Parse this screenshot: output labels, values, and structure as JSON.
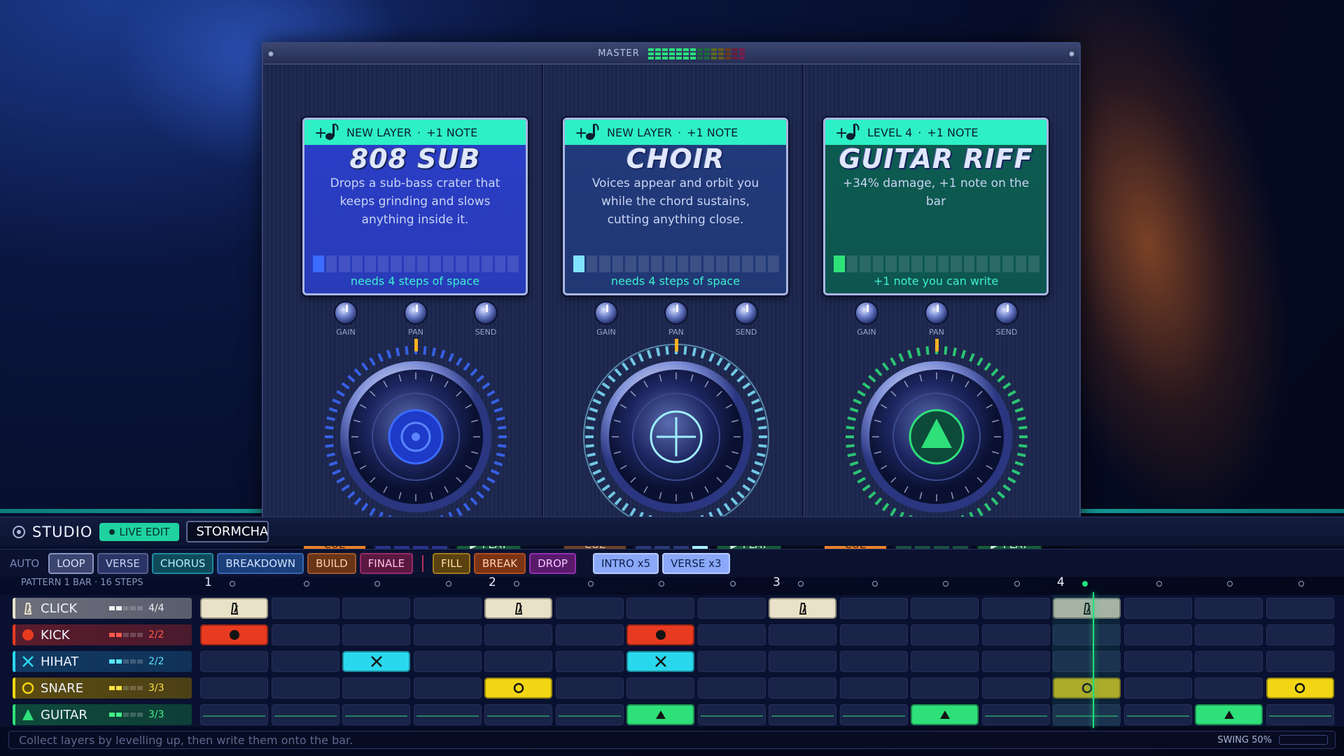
{
  "master": {
    "title": "MASTER"
  },
  "layers": [
    {
      "badge": "NEW LAYER",
      "bonus": "+1 NOTE",
      "name": "808 SUB",
      "description": "Drops a sub-bass crater that keeps grinding and slows anything inside it.",
      "footer": "needs 4 steps of space",
      "color": "#2a3ec8",
      "accent": "#3b6bff",
      "knobs": [
        "GAIN",
        "PAN",
        "SEND"
      ],
      "cue_label": "CUE",
      "play_label": "PLAY",
      "cue_active": true,
      "dial_icon": "target-icon"
    },
    {
      "badge": "NEW LAYER",
      "bonus": "+1 NOTE",
      "name": "CHOIR",
      "description": "Voices appear and orbit you while the chord sustains, cutting anything close.",
      "footer": "needs 4 steps of space",
      "color": "#213a7a",
      "accent": "#7fe4ff",
      "knobs": [
        "GAIN",
        "PAN",
        "SEND"
      ],
      "cue_label": "CUE",
      "play_label": "PLAY",
      "cue_active": false,
      "dial_icon": "crosshair-icon"
    },
    {
      "badge": "LEVEL 4",
      "bonus": "+1 NOTE",
      "name": "GUITAR RIFF",
      "description": "+34% damage, +1 note on the bar",
      "footer": "+1 note you can write",
      "color": "#0c5c50",
      "accent": "#2ee07a",
      "knobs": [
        "GAIN",
        "PAN",
        "SEND"
      ],
      "cue_label": "CUE",
      "play_label": "PLAY",
      "cue_active": true,
      "dial_icon": "triangle-icon"
    }
  ],
  "studio": {
    "title": "STUDIO",
    "live_edit": "LIVE EDIT",
    "song": "STORMCHA"
  },
  "sections": {
    "auto_label": "AUTO",
    "items": [
      {
        "label": "LOOP",
        "bg": "#3b4570",
        "fg": "#d6dcf4",
        "border": "#8a94c0"
      },
      {
        "label": "VERSE",
        "bg": "#2b3466",
        "fg": "#c8d0f0",
        "border": "#55608f"
      },
      {
        "label": "CHORUS",
        "bg": "#0e4a5a",
        "fg": "#aef0ff",
        "border": "#1f8aa0"
      },
      {
        "label": "BREAKDOWN",
        "bg": "#1b3f7a",
        "fg": "#cfe0ff",
        "border": "#3866b0"
      },
      {
        "label": "BUILD",
        "bg": "#6a3418",
        "fg": "#ffd0a8",
        "border": "#a0562c"
      },
      {
        "label": "FINALE",
        "bg": "#5a1840",
        "fg": "#ffc0e0",
        "border": "#962a6a"
      },
      {
        "label": "FILL",
        "bg": "#5a4210",
        "fg": "#ffe0a0",
        "border": "#a07a1c"
      },
      {
        "label": "BREAK",
        "bg": "#7a3414",
        "fg": "#ffd0b0",
        "border": "#b04e20"
      },
      {
        "label": "DROP",
        "bg": "#5a1a6a",
        "fg": "#f0c8ff",
        "border": "#9430b0"
      },
      {
        "label": "INTRO x5",
        "bg": "#8aa8f8",
        "fg": "#102050",
        "border": "#b8ccff"
      },
      {
        "label": "VERSE x3",
        "bg": "#8aa8f8",
        "fg": "#102050",
        "border": "#b8ccff"
      }
    ]
  },
  "pattern": {
    "label": "PATTERN  1 BAR · 16 STEPS",
    "beats": [
      "1",
      "2",
      "3",
      "4"
    ],
    "playhead_step": 13
  },
  "tracks": [
    {
      "name": "CLICK",
      "count": "4/4",
      "color": "#e9e2c8",
      "label_bg": "#6d6f7c",
      "count_color": "#f0f0f0",
      "icon": "metronome-icon",
      "steps": [
        1,
        5,
        9,
        13
      ]
    },
    {
      "name": "KICK",
      "count": "2/2",
      "color": "#e83a20",
      "label_bg": "#5a1c2c",
      "count_color": "#ff5a4a",
      "icon": "circle-icon",
      "steps": [
        1,
        7
      ]
    },
    {
      "name": "HIHAT",
      "count": "2/2",
      "color": "#2ad8ee",
      "label_bg": "#123a62",
      "count_color": "#5ae4ff",
      "icon": "x-icon",
      "steps": [
        3,
        7
      ]
    },
    {
      "name": "SNARE",
      "count": "3/3",
      "color": "#f2d614",
      "label_bg": "#5c4c10",
      "count_color": "#ffe040",
      "icon": "ring-icon",
      "steps": [
        5,
        13,
        16
      ]
    },
    {
      "name": "GUITAR",
      "count": "3/3",
      "color": "#2ee07a",
      "label_bg": "#0e4a3a",
      "count_color": "#44f08a",
      "icon": "triangle-icon",
      "steps": [
        7,
        11,
        15
      ]
    }
  ],
  "footer": {
    "hint": "Collect layers by levelling up, then write them onto the bar.",
    "swing": "SWING 50%"
  }
}
